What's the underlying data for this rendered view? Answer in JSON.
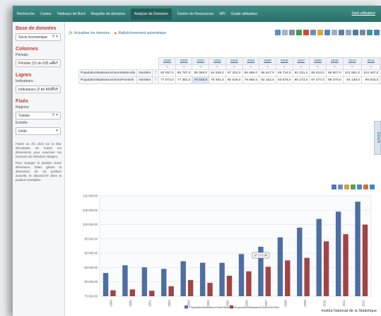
{
  "nav": {
    "items": [
      "Recherche",
      "Cartes",
      "Tableaux de Bord",
      "Requête de données",
      "Analyse de Données",
      "Centre de Ressources",
      "API",
      "Guide utilisateur"
    ],
    "active_index": 4,
    "right_link": "Saisi utilisateur"
  },
  "sidebar": {
    "database_title": "Base de données",
    "database_value": "Socio économique",
    "columns_title": "Colonnes",
    "period_label": "Période:",
    "period_value": "Période (15 de 635 séle...",
    "rows_title": "Lignes",
    "indicators_label": "Indicateurs:",
    "indicators_value": "Indicateurs (2 de 8436 s...",
    "fixed_title": "Fixés",
    "regions_label": "Régions:",
    "regions_value": "Tunisie",
    "scale_label": "Echelle:",
    "scale_value": "Unité",
    "help1": "Faites un clic droit sur la liste déroulante de toutes les dimensions pour examiner les fonctions de sélection élargies.",
    "help2": "Pour changer la position d'une dimension, faites glisser la dimension de sa position actuelle, et déposez-le dans la position souhaitée."
  },
  "toolbar": {
    "refresh_label": "Actualiser les données",
    "auto_refresh_label": "Rafraîchissement automatique"
  },
  "table": {
    "unit": "Nombre",
    "years": [
      "1999",
      "2000",
      "2001",
      "2002",
      "2003",
      "2004",
      "2005",
      "2006",
      "2007",
      "2008",
      "2009",
      "2010",
      "2011",
      "2012"
    ],
    "rows": [
      {
        "label": "PopulationNaissanceGenreMasculin",
        "values": [
          "83 097,0",
          "85 787,0",
          "85 069,0",
          "84 539,0",
          "87 202,0",
          "86 669,0",
          "86 647,0",
          "89 714,0",
          "92 231,0",
          "95 513,0",
          "98 907,0",
          "101 961,0",
          "104 497,0",
          "107 969,0"
        ]
      },
      {
        "label": "PopulationNaissanceGenreFeminin",
        "values": [
          "77 072,0",
          "77 362,0",
          "76 919,0",
          "78 481,0",
          "80 626,0",
          "79 660,0",
          "82 152,0",
          "83 676,0",
          "85 273,0",
          "87 477,0",
          "88 379,0",
          "94 138,0",
          "96 633,0",
          "99 961,0"
        ]
      }
    ],
    "highlight_cell": "76 919,0",
    "side_tab": "Détails"
  },
  "chart_data": {
    "type": "bar",
    "categories": [
      "1999",
      "2000",
      "2001",
      "2002",
      "2003",
      "2004",
      "2005",
      "2006",
      "2007",
      "2008",
      "2009",
      "2010",
      "2011",
      "2012"
    ],
    "series": [
      {
        "name": "PopulationNaissanceGenreMasculin",
        "color": "#4e6ea3",
        "values": [
          83097,
          85787,
          85069,
          84539,
          87202,
          86669,
          86647,
          89714,
          92231,
          95513,
          98907,
          101961,
          104497,
          107969
        ]
      },
      {
        "name": "PopulationNaissanceGenreFeminin",
        "color": "#a04446",
        "values": [
          77072,
          77362,
          76919,
          78481,
          80626,
          79660,
          82152,
          83676,
          85273,
          87477,
          88379,
          94138,
          96633,
          99961
        ]
      }
    ],
    "ylim": [
      75000,
      110000
    ],
    "ytick_labels": [
      "75 000,00",
      "80 000,00",
      "85 000,00",
      "90 000,00",
      "95 000,00",
      "100 000,00",
      "105 000,00",
      "110 000,00"
    ],
    "tooltip": "87 273,00",
    "legend_position": "bottom",
    "grid": true
  },
  "footer": "Institut National de la Statistique"
}
